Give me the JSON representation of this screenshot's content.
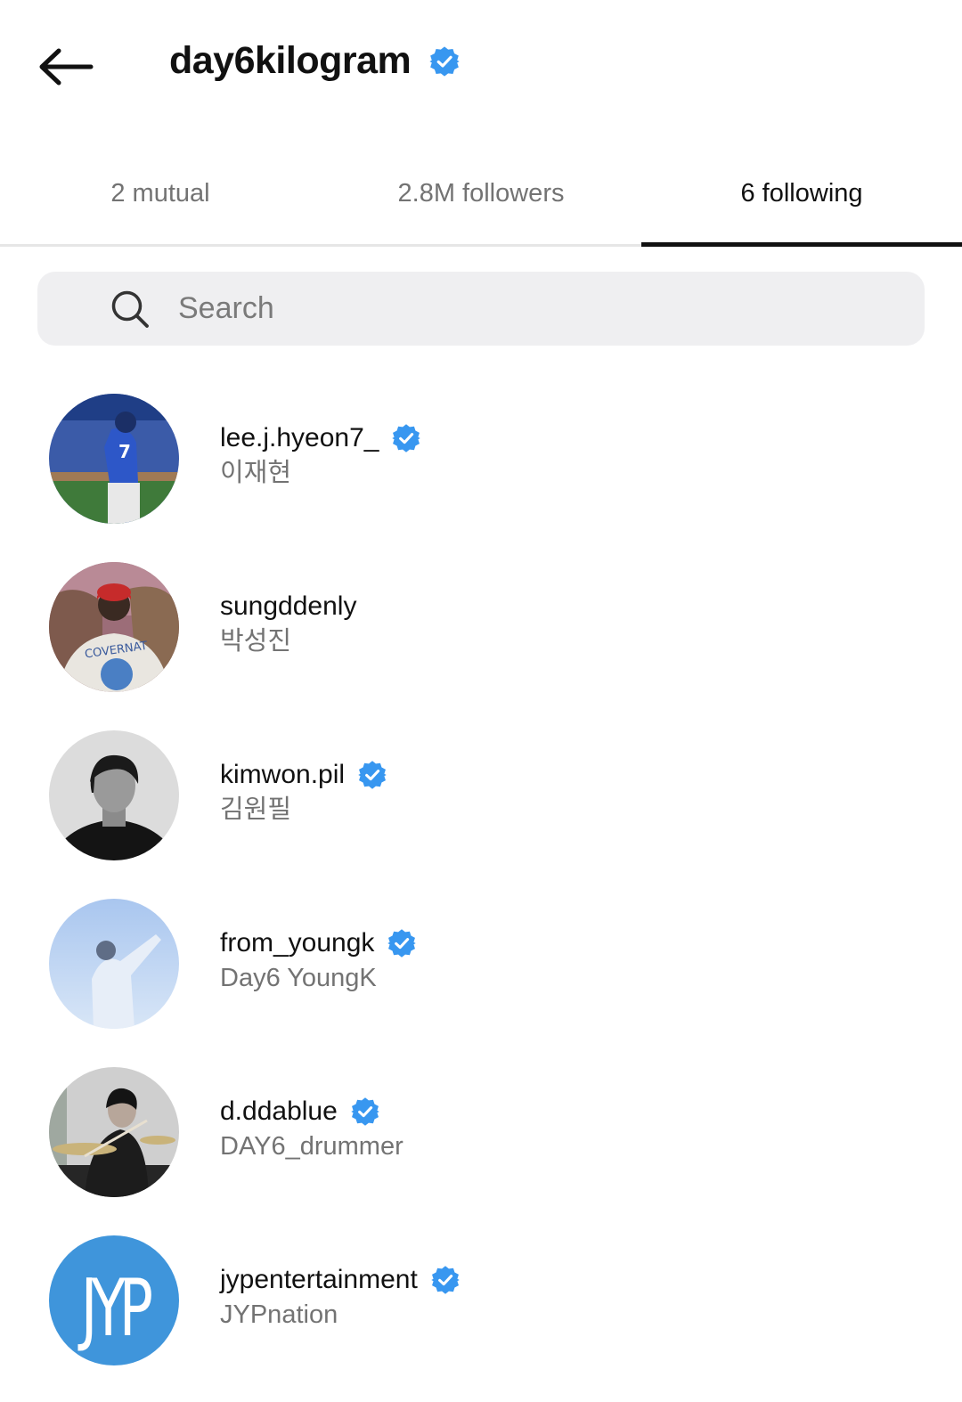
{
  "header": {
    "username": "day6kilogram",
    "verified": true
  },
  "tabs": [
    {
      "label": "2 mutual",
      "active": false
    },
    {
      "label": "2.8M followers",
      "active": false
    },
    {
      "label": "6 following",
      "active": true
    }
  ],
  "search": {
    "placeholder": "Search"
  },
  "accounts": [
    {
      "username": "lee.j.hyeon7_",
      "name": "이재현",
      "verified": true
    },
    {
      "username": "sungddenly",
      "name": "박성진",
      "verified": false
    },
    {
      "username": "kimwon.pil",
      "name": "김원필",
      "verified": true
    },
    {
      "username": "from_youngk",
      "name": "Day6 YoungK",
      "verified": true
    },
    {
      "username": "d.ddablue",
      "name": "DAY6_drummer",
      "verified": true
    },
    {
      "username": "jypentertainment",
      "name": "JYPnation",
      "verified": true
    }
  ],
  "jyp_logo_text": "JYP",
  "colors": {
    "verified_blue": "#3897f0",
    "jyp_blue": "#3f95db",
    "muted_text": "#737373"
  }
}
